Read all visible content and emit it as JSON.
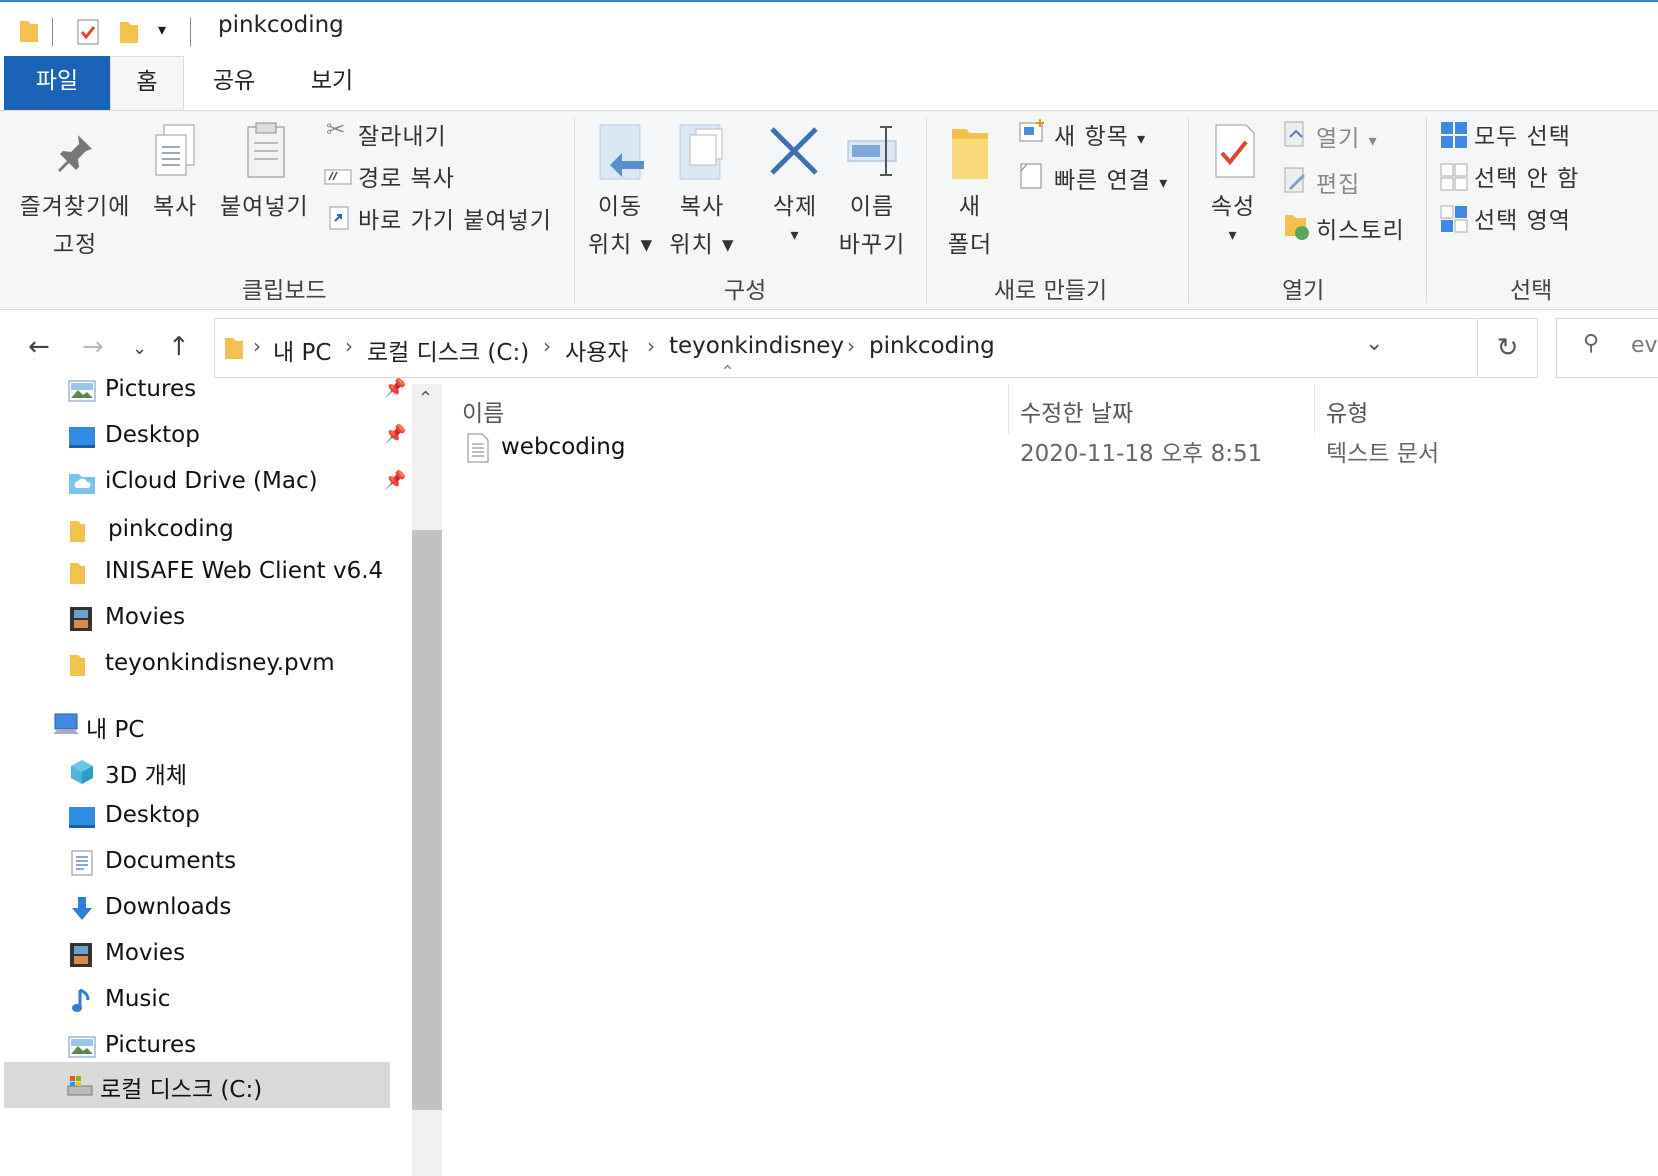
{
  "window": {
    "title": "pinkcoding"
  },
  "tabs": [
    {
      "label": "파일"
    },
    {
      "label": "홈"
    },
    {
      "label": "공유"
    },
    {
      "label": "보기"
    }
  ],
  "ribbon": {
    "clipboard": {
      "pin_line1": "즐겨찾기에",
      "pin_line2": "고정",
      "copy": "복사",
      "paste": "붙여넣기",
      "cut": "잘라내기",
      "copy_path": "경로 복사",
      "paste_shortcut": "바로 가기 붙여넣기",
      "group": "클립보드"
    },
    "organize": {
      "move_line1": "이동",
      "move_line2": "위치",
      "copyto_line1": "복사",
      "copyto_line2": "위치",
      "delete": "삭제",
      "rename_line1": "이름",
      "rename_line2": "바꾸기",
      "group": "구성"
    },
    "new": {
      "folder_line1": "새",
      "folder_line2": "폴더",
      "new_item": "새 항목",
      "easy_access": "빠른 연결",
      "group": "새로 만들기"
    },
    "open": {
      "properties": "속성",
      "open": "열기",
      "edit": "편집",
      "history": "히스토리",
      "group": "열기"
    },
    "select": {
      "select_all": "모두 선택",
      "select_none": "선택 안 함",
      "invert": "선택 영역",
      "group": "선택"
    }
  },
  "address": {
    "crumbs": [
      "내 PC",
      "로컬 디스크 (C:)",
      "사용자",
      "teyonkindisney",
      "pinkcoding"
    ],
    "search_partial": "ev"
  },
  "navpane": {
    "items": [
      {
        "label": "Pictures",
        "icon": "pictures-icon",
        "pinned": true
      },
      {
        "label": "Desktop",
        "icon": "desktop-icon",
        "pinned": true
      },
      {
        "label": "iCloud Drive (Mac)",
        "icon": "cloud-folder-icon",
        "pinned": true
      },
      {
        "label": "pinkcoding",
        "icon": "folder-icon",
        "pinned": false
      },
      {
        "label": "INISAFE Web Client v6.4",
        "icon": "folder-icon",
        "pinned": false
      },
      {
        "label": "Movies",
        "icon": "movies-icon",
        "pinned": false
      },
      {
        "label": "teyonkindisney.pvm",
        "icon": "folder-icon",
        "pinned": false
      },
      {
        "label": "내 PC",
        "icon": "computer-icon",
        "pinned": false
      },
      {
        "label": "3D 개체",
        "icon": "3d-objects-icon",
        "pinned": false
      },
      {
        "label": "Desktop",
        "icon": "desktop-icon",
        "pinned": false
      },
      {
        "label": "Documents",
        "icon": "documents-icon",
        "pinned": false
      },
      {
        "label": "Downloads",
        "icon": "downloads-icon",
        "pinned": false
      },
      {
        "label": "Movies",
        "icon": "movies-icon",
        "pinned": false
      },
      {
        "label": "Music",
        "icon": "music-icon",
        "pinned": false
      },
      {
        "label": "Pictures",
        "icon": "pictures-icon",
        "pinned": false
      },
      {
        "label": "로컬 디스크 (C:)",
        "icon": "drive-icon",
        "pinned": false,
        "selected": true
      }
    ]
  },
  "content": {
    "columns": {
      "name": "이름",
      "modified": "수정한 날짜",
      "type": "유형"
    },
    "files": [
      {
        "name": "webcoding",
        "modified": "2020-11-18 오후 8:51",
        "type": "텍스트 문서"
      }
    ]
  },
  "colors": {
    "accent": "#1a63b8",
    "folder": "#f7c948",
    "selected": "#d9d9d9"
  }
}
